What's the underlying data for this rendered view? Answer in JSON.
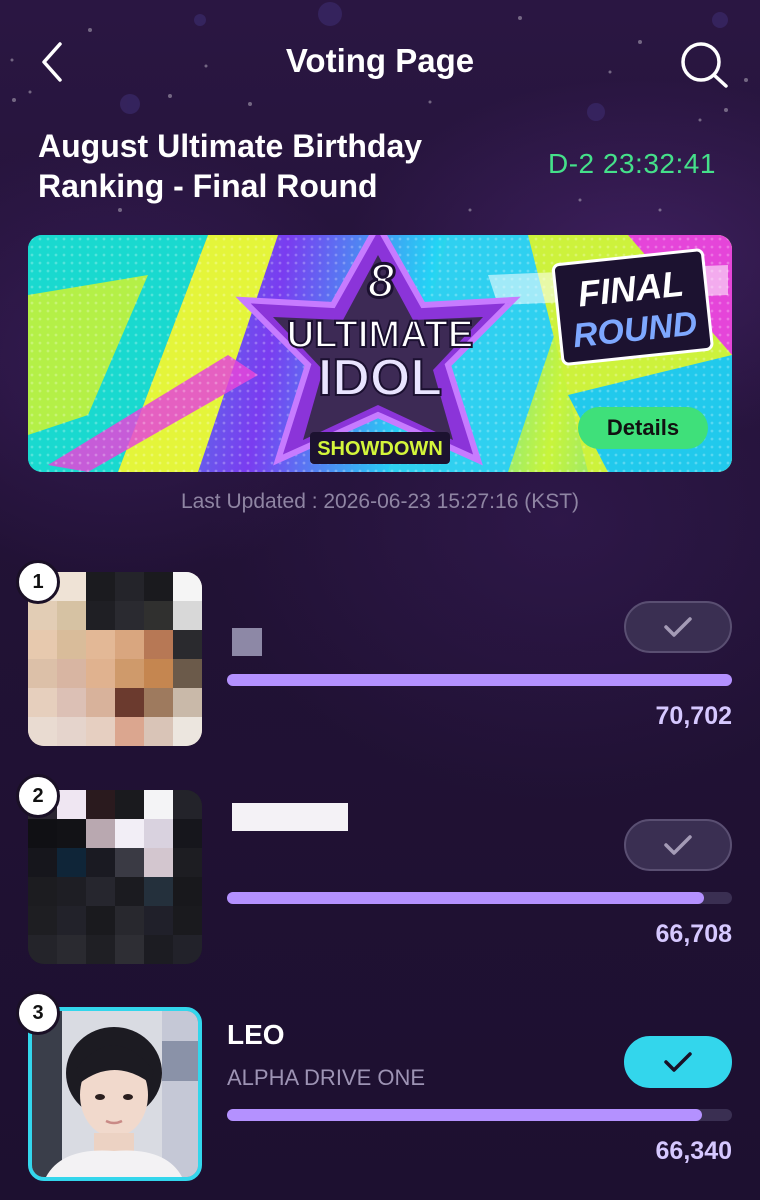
{
  "header": {
    "title": "Voting Page",
    "back_icon": "chevron-left-icon",
    "search_icon": "search-icon"
  },
  "event": {
    "title_line1": "August Ultimate Birthday",
    "title_line2": "Ranking - Final Round",
    "countdown": "D-2 23:32:41"
  },
  "banner": {
    "badge_number": "8",
    "line1": "ULTIMATE",
    "line2": "IDOL",
    "ribbon": "SHOWDOWN",
    "stamp_line1": "FINAL",
    "stamp_line2": "ROUND",
    "details_label": "Details"
  },
  "last_updated": "Last Updated : 2026-06-23 15:27:16 (KST)",
  "colors": {
    "accent_green": "#45e08a",
    "bar_fill": "#b491ff",
    "vote_active": "#33d6ec",
    "background": "#221236"
  },
  "ranking": [
    {
      "rank": "1",
      "name": "",
      "group": "",
      "votes": "70,702",
      "progress": 1.0,
      "voted": false
    },
    {
      "rank": "2",
      "name": "",
      "group": "",
      "votes": "66,708",
      "progress": 0.945,
      "voted": false
    },
    {
      "rank": "3",
      "name": "LEO",
      "group": "ALPHA DRIVE ONE",
      "votes": "66,340",
      "progress": 0.94,
      "voted": true
    }
  ]
}
